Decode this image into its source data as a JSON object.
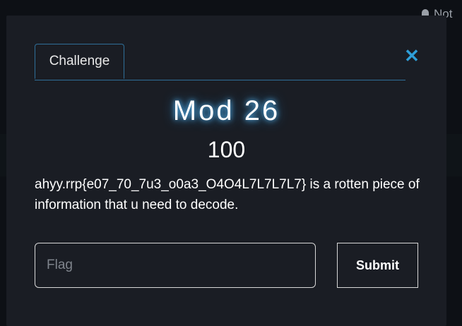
{
  "topbar": {
    "notifications_label": "Not",
    "bell_icon": "bell-icon"
  },
  "modal": {
    "tab_label": "Challenge",
    "close_icon": "close-icon",
    "close_glyph": "✕",
    "title": "Mod 26",
    "value": "100",
    "description": "ahyy.rrp{e07_70_7u3_o0a3_O4O4L7L7L7L7} is a rotten piece of information that u need to decode.",
    "flag_placeholder": "Flag",
    "flag_value": "",
    "submit_label": "Submit"
  },
  "colors": {
    "accent": "#2e9fd8",
    "modal_bg": "#1a1d24",
    "page_bg": "#0d1015"
  }
}
